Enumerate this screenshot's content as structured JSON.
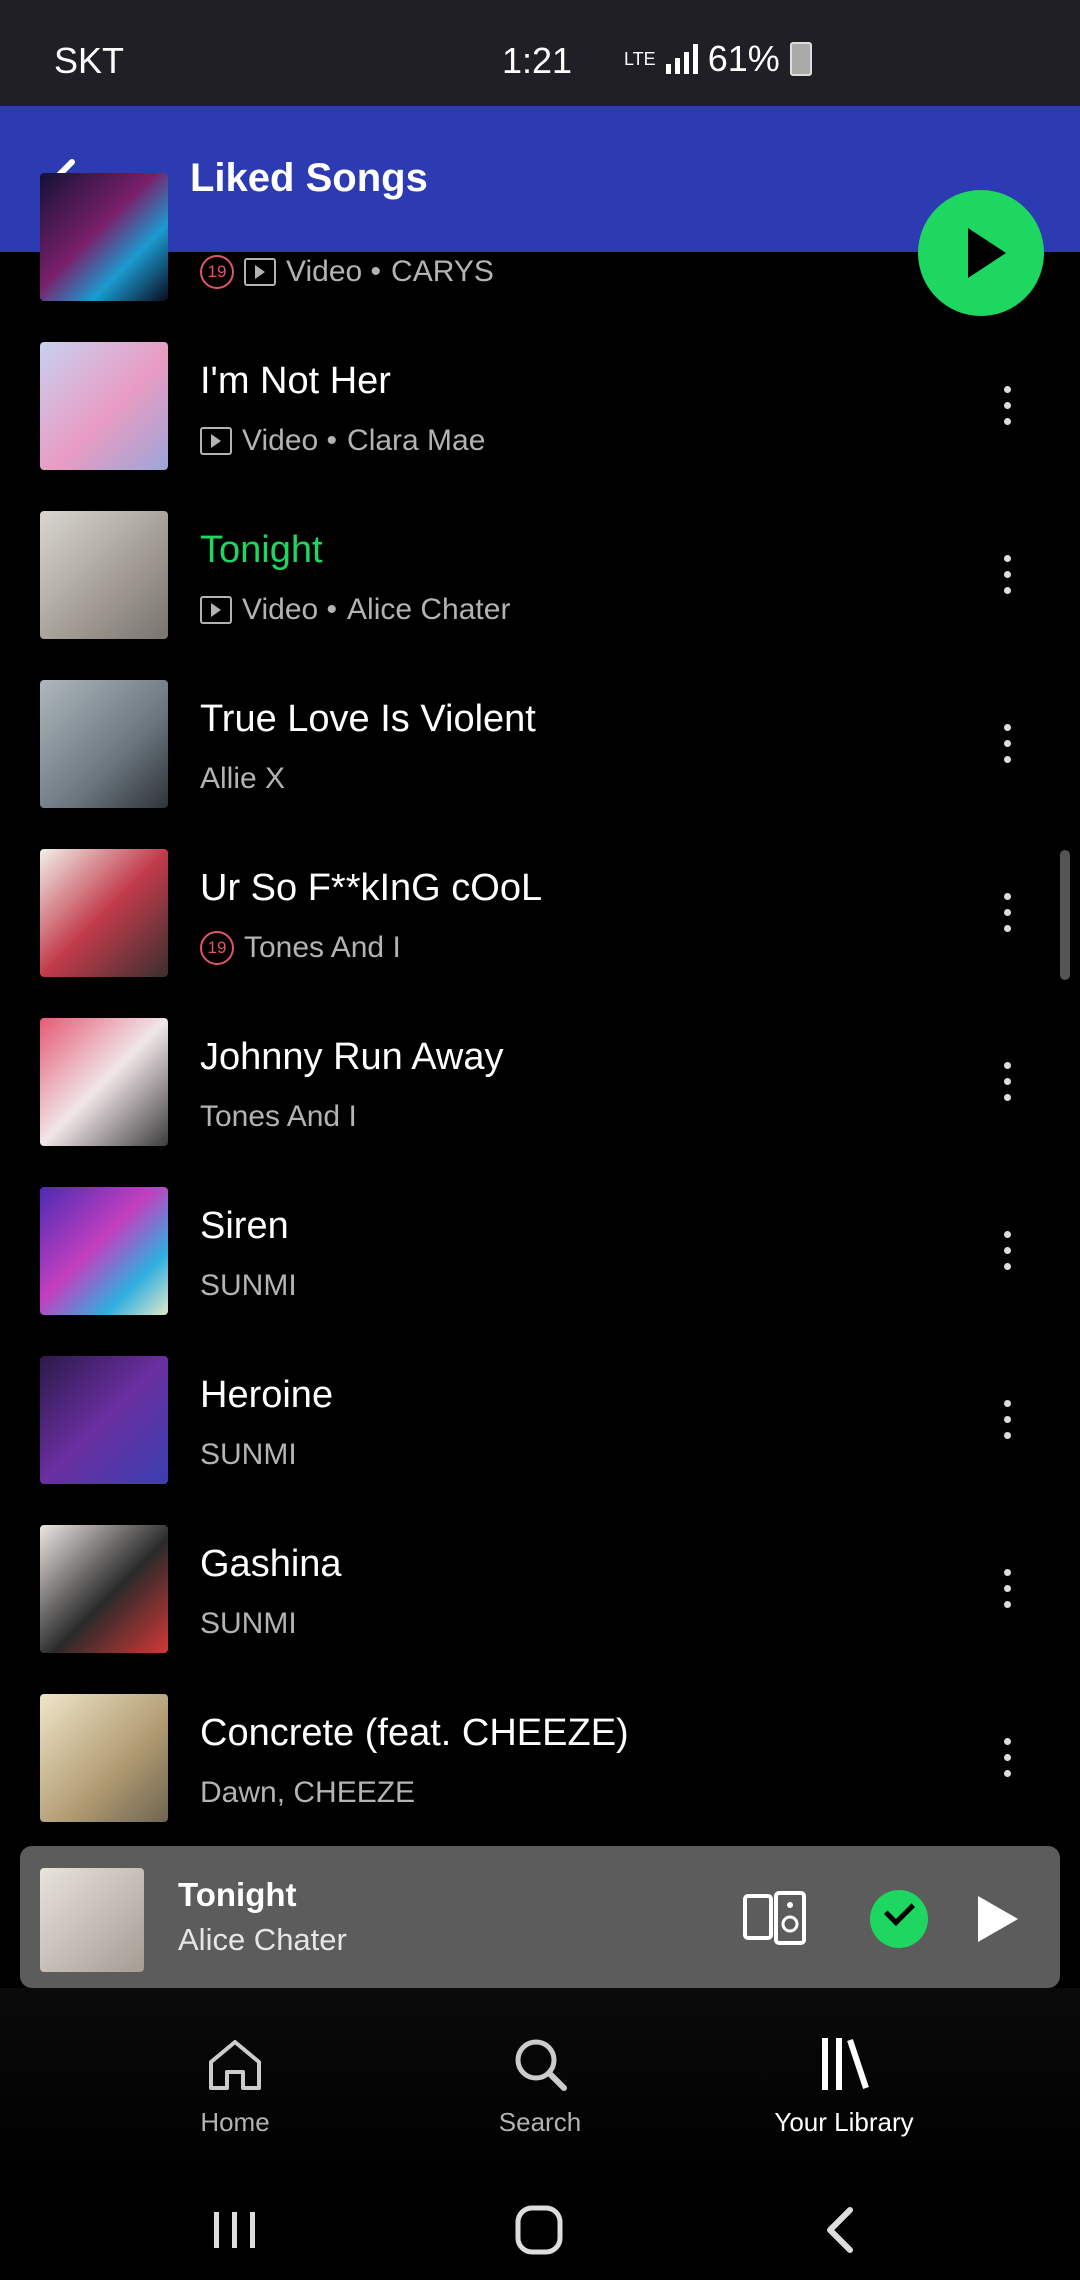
{
  "status_bar": {
    "carrier": "SKT",
    "time": "1:21",
    "network": "LTE",
    "battery": "61%"
  },
  "header": {
    "title": "Liked Songs"
  },
  "songs": [
    {
      "title": "",
      "video": true,
      "explicit": true,
      "meta": "Video •",
      "artist": "CARYS",
      "active": false
    },
    {
      "title": "I'm Not Her",
      "video": true,
      "explicit": false,
      "meta": "Video •",
      "artist": "Clara Mae",
      "active": false
    },
    {
      "title": "Tonight",
      "video": true,
      "explicit": false,
      "meta": "Video •",
      "artist": "Alice Chater",
      "active": true
    },
    {
      "title": "True Love Is Violent",
      "video": false,
      "explicit": false,
      "meta": "",
      "artist": "Allie X",
      "active": false
    },
    {
      "title": "Ur So F**kInG cOoL",
      "video": false,
      "explicit": true,
      "meta": "",
      "artist": "Tones And I",
      "active": false
    },
    {
      "title": "Johnny Run Away",
      "video": false,
      "explicit": false,
      "meta": "",
      "artist": "Tones And I",
      "active": false
    },
    {
      "title": "Siren",
      "video": false,
      "explicit": false,
      "meta": "",
      "artist": "SUNMI",
      "active": false
    },
    {
      "title": "Heroine",
      "video": false,
      "explicit": false,
      "meta": "",
      "artist": "SUNMI",
      "active": false
    },
    {
      "title": "Gashina",
      "video": false,
      "explicit": false,
      "meta": "",
      "artist": "SUNMI",
      "active": false
    },
    {
      "title": "Concrete (feat. CHEEZE)",
      "video": false,
      "explicit": false,
      "meta": "",
      "artist": "Dawn, CHEEZE",
      "active": false
    }
  ],
  "explicit_badge": "19",
  "mini_player": {
    "title": "Tonight",
    "artist": "Alice Chater"
  },
  "nav": {
    "home": "Home",
    "search": "Search",
    "library": "Your Library"
  },
  "colors": {
    "accent": "#1ed760",
    "header": "#2d3bb3"
  }
}
